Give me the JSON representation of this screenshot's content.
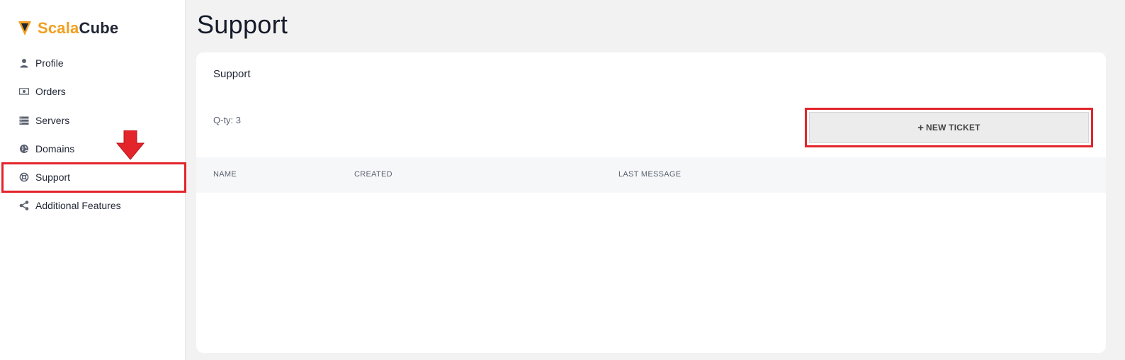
{
  "brand": {
    "name_part1": "Scala",
    "name_part2": "Cube",
    "accent": "#f0a020",
    "dark": "#1f2533"
  },
  "sidebar": {
    "items": [
      {
        "label": "Profile",
        "icon": "user-icon"
      },
      {
        "label": "Orders",
        "icon": "money-icon"
      },
      {
        "label": "Servers",
        "icon": "server-icon"
      },
      {
        "label": "Domains",
        "icon": "globe-icon"
      },
      {
        "label": "Support",
        "icon": "lifering-icon",
        "highlighted": true
      },
      {
        "label": "Additional Features",
        "icon": "share-icon"
      }
    ]
  },
  "page": {
    "title": "Support"
  },
  "card": {
    "title": "Support",
    "qty_label": "Q-ty: 3",
    "new_ticket": {
      "plus": "+",
      "label": "NEW TICKET"
    },
    "table": {
      "columns": [
        "NAME",
        "CREATED",
        "LAST MESSAGE"
      ]
    }
  },
  "annotations": {
    "highlight_color": "#e3242b"
  }
}
